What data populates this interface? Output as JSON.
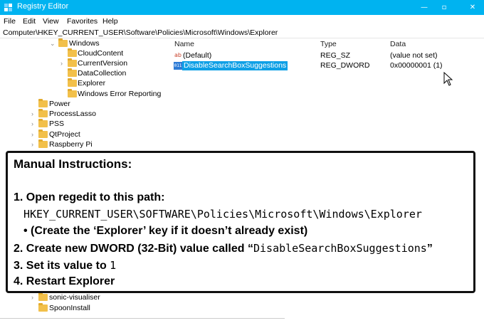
{
  "window": {
    "title": "Registry Editor",
    "controls": {
      "minimize": "—",
      "maximize": "▫",
      "close": "✕"
    }
  },
  "menu": [
    "File",
    "Edit",
    "View",
    "Favorites",
    "Help"
  ],
  "address": "Computer\\HKEY_CURRENT_USER\\Software\\Policies\\Microsoft\\Windows\\Explorer",
  "tree": [
    {
      "label": "Windows",
      "chevron": "⌄"
    },
    {
      "label": "CloudContent",
      "chevron": ""
    },
    {
      "label": "CurrentVersion",
      "chevron": "›"
    },
    {
      "label": "DataCollection",
      "chevron": ""
    },
    {
      "label": "Explorer",
      "chevron": ""
    },
    {
      "label": "Windows Error Reporting",
      "chevron": ""
    },
    {
      "label": "Power",
      "chevron": ""
    },
    {
      "label": "ProcessLasso",
      "chevron": "›"
    },
    {
      "label": "PSS",
      "chevron": "›"
    },
    {
      "label": "QtProject",
      "chevron": "›"
    },
    {
      "label": "Raspberry Pi",
      "chevron": "›"
    },
    {
      "label": "sonic-visualiser",
      "chevron": "›"
    },
    {
      "label": "SpoonInstall",
      "chevron": ""
    }
  ],
  "columns": {
    "name": "Name",
    "type": "Type",
    "data": "Data"
  },
  "values": [
    {
      "icon": "ab",
      "name": "(Default)",
      "type": "REG_SZ",
      "data": "(value not set)"
    },
    {
      "icon": "011",
      "name": "DisableSearchBoxSuggestions",
      "type": "REG_DWORD",
      "data": "0x00000001 (1)"
    }
  ],
  "instructions": {
    "heading": "Manual Instructions:",
    "step1": "1. Open regedit to this path:",
    "path": "HKEY_CURRENT_USER\\SOFTWARE\\Policies\\Microsoft\\Windows\\Explorer",
    "note": "• (Create the ‘Explorer’ key if it doesn’t already exist)",
    "step2_prefix": "2. Create new DWORD (32-Bit) value called “",
    "step2_value": "DisableSearchBoxSuggestions",
    "step2_suffix": "”",
    "step3_prefix": "3. Set its value to ",
    "step3_value": "1",
    "step4": "4. Restart Explorer"
  },
  "colors": {
    "titlebar": "#00b3f0",
    "selection": "#0ea0e6",
    "folder": "#f2c04a"
  }
}
